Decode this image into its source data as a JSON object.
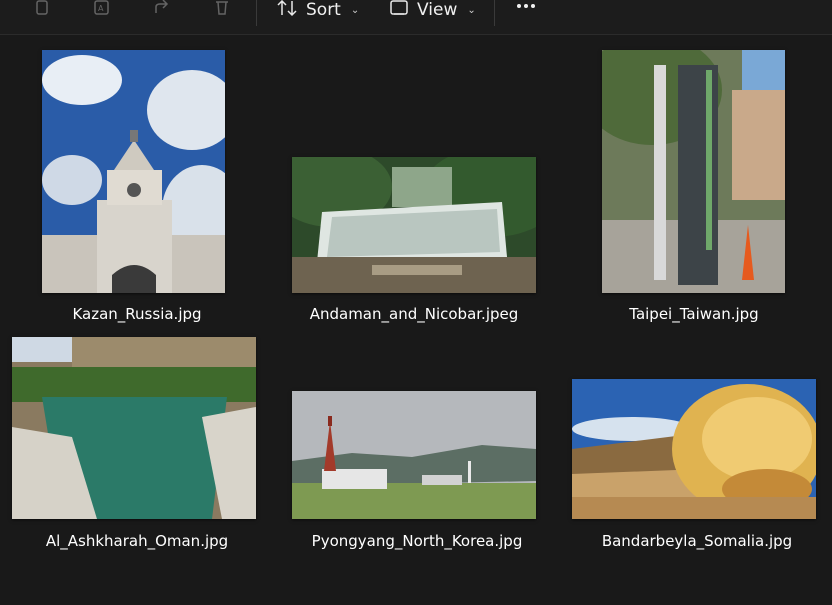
{
  "toolbar": {
    "icons": [
      "copy-icon",
      "rename-icon",
      "share-icon",
      "delete-icon"
    ],
    "sort_label": "Sort",
    "view_label": "View",
    "more_icon": "more-icon"
  },
  "files": [
    {
      "name": "Kazan_Russia.jpg",
      "subject": "kremlin tower under cloudy blue sky"
    },
    {
      "name": "Andaman_and_Nicobar.jpeg",
      "subject": "waterfall in forest"
    },
    {
      "name": "Taipei_Taiwan.jpg",
      "subject": "street sign pole and trees"
    },
    {
      "name": "Al_Ashkharah_Oman.jpg",
      "subject": "green river in rocky canyon"
    },
    {
      "name": "Pyongyang_North_Korea.jpg",
      "subject": "pagoda with hills and field"
    },
    {
      "name": "Bandarbeyla_Somalia.jpg",
      "subject": "eroded sandstone rock formation"
    }
  ],
  "colors": {
    "background": "#191919",
    "toolbar": "#1c1c1c",
    "text": "#ffffff"
  }
}
